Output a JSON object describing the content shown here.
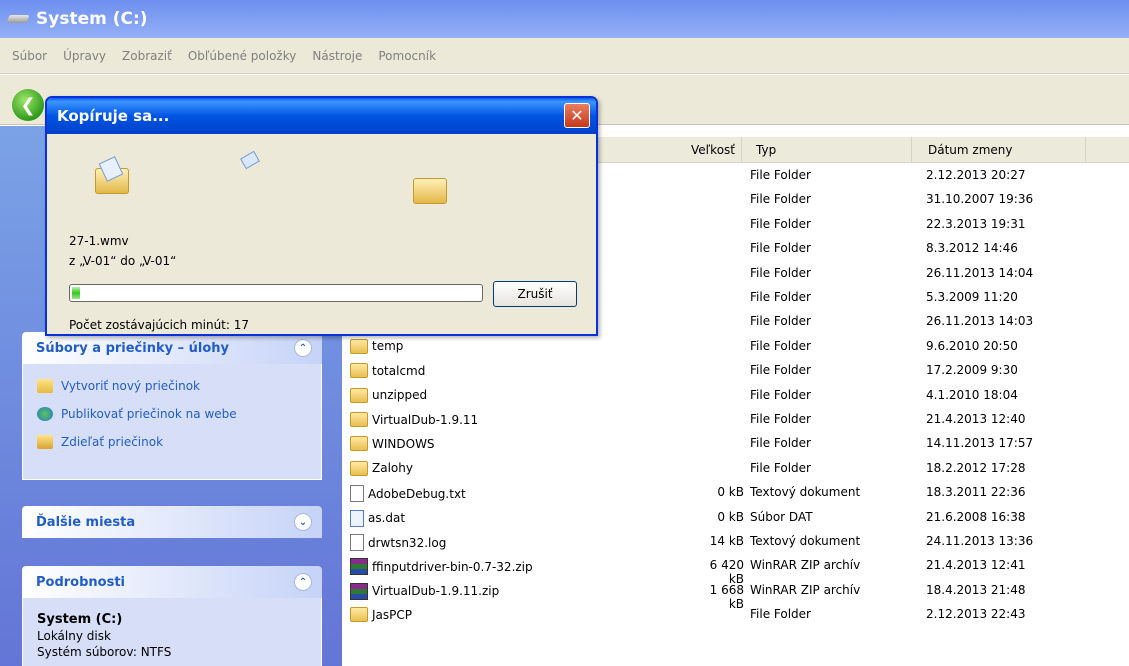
{
  "window": {
    "title": "System (C:)"
  },
  "menu": [
    "Súbor",
    "Úpravy",
    "Zobraziť",
    "Obľúbené položky",
    "Nástroje",
    "Pomocník"
  ],
  "columns": {
    "size": "Veľkosť",
    "type": "Typ",
    "date": "Dátum zmeny"
  },
  "dialog": {
    "title": "Kopíruje sa...",
    "close_glyph": "✕",
    "filename": "27-1.wmv",
    "from_to": "z „V-01“ do „V-01“",
    "progress": 0.02,
    "cancel_label": "Zrušiť",
    "remaining": "Počet zostávajúcich minút: 17"
  },
  "tasks_panel": {
    "title": "Súbory a priečinky – úlohy",
    "items": [
      "Vytvoriť nový priečinok",
      "Publikovať priečinok na webe",
      "Zdieľať priečinok"
    ]
  },
  "places_panel": {
    "title": "Ďalšie miesta"
  },
  "details_panel": {
    "title": "Podrobnosti",
    "name": "System (C:)",
    "kind": "Lokálny disk",
    "fs": "Systém súborov: NTFS"
  },
  "rows": [
    {
      "name": "",
      "size": "",
      "type": "File Folder",
      "date": "2.12.2013 20:27",
      "icon": "none"
    },
    {
      "name": "",
      "size": "",
      "type": "File Folder",
      "date": "31.10.2007 19:36",
      "icon": "none"
    },
    {
      "name": "",
      "size": "",
      "type": "File Folder",
      "date": "22.3.2013 19:31",
      "icon": "none"
    },
    {
      "name": "",
      "size": "",
      "type": "File Folder",
      "date": "8.3.2012 14:46",
      "icon": "none"
    },
    {
      "name": "",
      "size": "",
      "type": "File Folder",
      "date": "26.11.2013 14:04",
      "icon": "none"
    },
    {
      "name": "",
      "size": "",
      "type": "File Folder",
      "date": "5.3.2009 11:20",
      "icon": "none"
    },
    {
      "name": "",
      "size": "",
      "type": "File Folder",
      "date": "26.11.2013 14:03",
      "icon": "none"
    },
    {
      "name": "temp",
      "size": "",
      "type": "File Folder",
      "date": "9.6.2010 20:50",
      "icon": "folder"
    },
    {
      "name": "totalcmd",
      "size": "",
      "type": "File Folder",
      "date": "17.2.2009 9:30",
      "icon": "folder"
    },
    {
      "name": "unzipped",
      "size": "",
      "type": "File Folder",
      "date": "4.1.2010 18:04",
      "icon": "folder"
    },
    {
      "name": "VirtualDub-1.9.11",
      "size": "",
      "type": "File Folder",
      "date": "21.4.2013 12:40",
      "icon": "folder"
    },
    {
      "name": "WINDOWS",
      "size": "",
      "type": "File Folder",
      "date": "14.11.2013 17:57",
      "icon": "folder"
    },
    {
      "name": "Zalohy",
      "size": "",
      "type": "File Folder",
      "date": "18.2.2012 17:28",
      "icon": "folder"
    },
    {
      "name": "AdobeDebug.txt",
      "size": "0 kB",
      "type": "Textový dokument",
      "date": "18.3.2011 22:36",
      "icon": "txt"
    },
    {
      "name": "as.dat",
      "size": "0 kB",
      "type": "Súbor DAT",
      "date": "21.6.2008 16:38",
      "icon": "dat"
    },
    {
      "name": "drwtsn32.log",
      "size": "14 kB",
      "type": "Textový dokument",
      "date": "24.11.2013 13:36",
      "icon": "txt"
    },
    {
      "name": "ffinputdriver-bin-0.7-32.zip",
      "size": "6 420 kB",
      "type": "WinRAR ZIP archív",
      "date": "21.4.2013 12:41",
      "icon": "zip"
    },
    {
      "name": "VirtualDub-1.9.11.zip",
      "size": "1 668 kB",
      "type": "WinRAR ZIP archív",
      "date": "18.4.2013 21:48",
      "icon": "zip"
    },
    {
      "name": "JasPCP",
      "size": "",
      "type": "File Folder",
      "date": "2.12.2013 22:43",
      "icon": "folder"
    }
  ]
}
